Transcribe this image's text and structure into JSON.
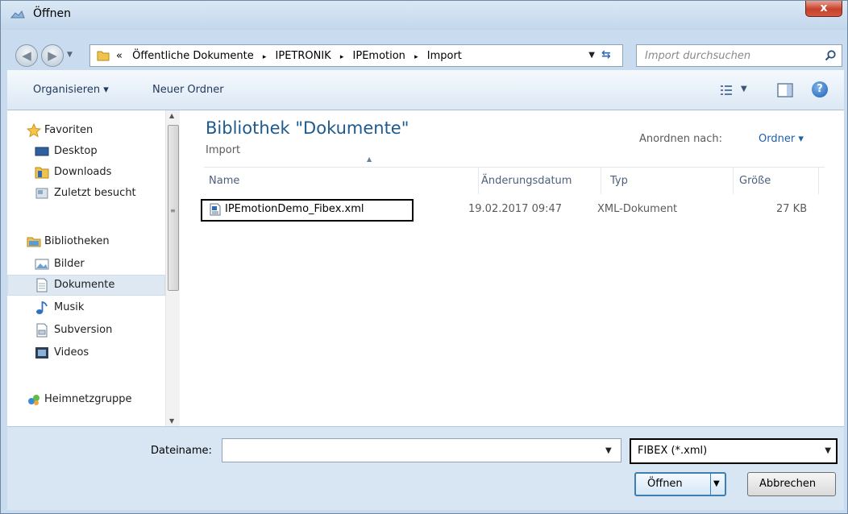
{
  "window": {
    "title": "Öffnen",
    "close_glyph": "x"
  },
  "address": {
    "overflow": "«",
    "crumbs": [
      "Öffentliche Dokumente",
      "IPETRONIK",
      "IPEmotion",
      "Import"
    ],
    "separator": "▸"
  },
  "search": {
    "placeholder": "Import durchsuchen"
  },
  "toolbar": {
    "organize_label": "Organisieren ▾",
    "new_folder_label": "Neuer Ordner",
    "help_glyph": "?"
  },
  "sidebar": {
    "items": [
      {
        "label": "Favoriten",
        "icon": "star-icon",
        "selected": false
      },
      {
        "label": "Desktop",
        "icon": "desktop-icon",
        "selected": false
      },
      {
        "label": "Downloads",
        "icon": "downloads-folder-icon",
        "selected": false
      },
      {
        "label": "Zuletzt besucht",
        "icon": "recent-places-icon",
        "selected": false
      },
      {
        "label": "Bibliotheken",
        "icon": "libraries-icon",
        "selected": false
      },
      {
        "label": "Bilder",
        "icon": "pictures-icon",
        "selected": false
      },
      {
        "label": "Dokumente",
        "icon": "documents-icon",
        "selected": true
      },
      {
        "label": "Musik",
        "icon": "music-icon",
        "selected": false
      },
      {
        "label": "Subversion",
        "icon": "subversion-icon",
        "selected": false
      },
      {
        "label": "Videos",
        "icon": "videos-icon",
        "selected": false
      },
      {
        "label": "Heimnetzgruppe",
        "icon": "homegroup-icon",
        "selected": false
      }
    ]
  },
  "library": {
    "title": "Bibliothek \"Dokumente\"",
    "subtitle": "Import",
    "arrange_label": "Anordnen nach:",
    "arrange_value": "Ordner ▾"
  },
  "columns": {
    "name": "Name",
    "date": "Änderungsdatum",
    "type": "Typ",
    "size": "Größe"
  },
  "files": [
    {
      "name": "IPEmotionDemo_Fibex.xml",
      "date": "19.02.2017 09:47",
      "type": "XML-Dokument",
      "size": "27 KB"
    }
  ],
  "footer": {
    "filename_label": "Dateiname:",
    "filename_value": "",
    "filter_value": "FIBEX (*.xml)",
    "open_label": "Öffnen",
    "cancel_label": "Abbrechen"
  },
  "colors": {
    "accent": "#1e5a8e",
    "selection": "#dde8f3",
    "highlight_box": "#000000"
  }
}
